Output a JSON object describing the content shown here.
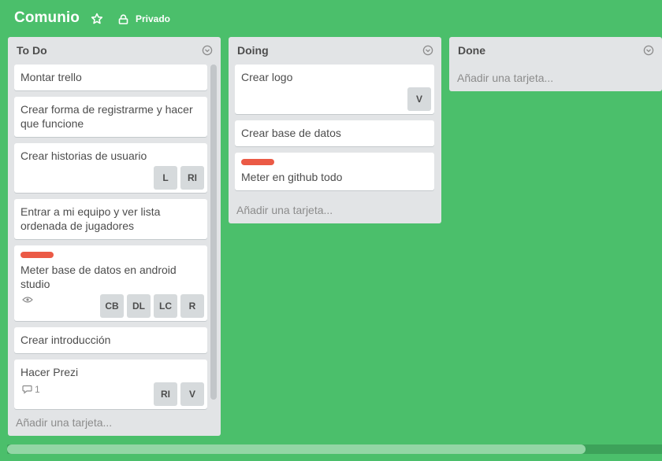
{
  "board": {
    "title": "Comunio",
    "visibility": "Privado"
  },
  "lists": [
    {
      "title": "To Do",
      "add_card": "Añadir una tarjeta...",
      "cards": [
        {
          "title": "Montar trello",
          "members": []
        },
        {
          "title": "Crear forma de registrarme y hacer que funcione",
          "members": []
        },
        {
          "title": "Crear historias de usuario",
          "members": [
            "L",
            "RI"
          ]
        },
        {
          "title": "Entrar a mi equipo y ver lista ordenada de jugadores",
          "members": []
        },
        {
          "title": "Meter base de datos en android studio",
          "label_color": "#eb5a46",
          "badges": {
            "watching": true
          },
          "members": [
            "CB",
            "DL",
            "LC",
            "R"
          ]
        },
        {
          "title": "Crear introducción",
          "members": []
        },
        {
          "title": "Hacer Prezi",
          "badges": {
            "comments": "1"
          },
          "members": [
            "RI",
            "V"
          ]
        }
      ]
    },
    {
      "title": "Doing",
      "add_card": "Añadir una tarjeta...",
      "cards": [
        {
          "title": "Crear logo",
          "members": [
            "V"
          ]
        },
        {
          "title": "Crear base de datos",
          "members": []
        },
        {
          "title": "Meter en github todo",
          "label_color": "#eb5a46",
          "members": []
        }
      ]
    },
    {
      "title": "Done",
      "add_card": "Añadir una tarjeta...",
      "cards": []
    }
  ],
  "colors": {
    "board_background": "#4bbf6b",
    "list_background": "#e2e4e6",
    "label_red": "#eb5a46"
  }
}
